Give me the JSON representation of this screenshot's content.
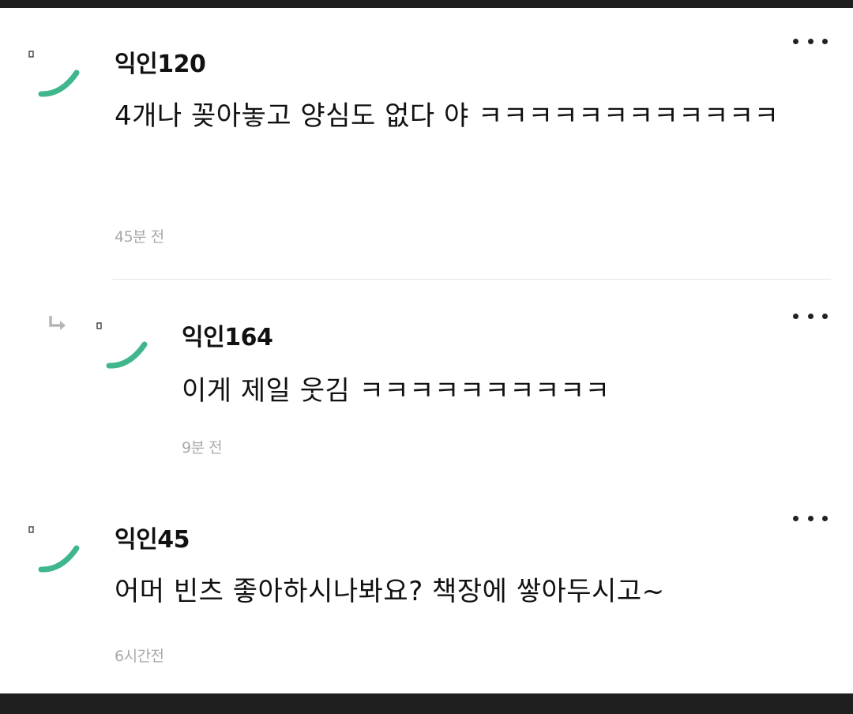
{
  "comments": [
    {
      "username": "익인120",
      "text": "4개나 꽂아놓고 양심도 없다 야 ㅋㅋㅋㅋㅋㅋㅋㅋㅋㅋㅋㅋ",
      "time": "45분 전",
      "avatar_icon": "avatar-arc-icon",
      "is_reply": false
    },
    {
      "username": "익인164",
      "text": "이게 제일 웃김 ㅋㅋㅋㅋㅋㅋㅋㅋㅋㅋ",
      "time": "9분 전",
      "avatar_icon": "avatar-arc-icon",
      "is_reply": true
    },
    {
      "username": "익인45",
      "text": "어머 빈츠 좋아하시나봐요? 책장에 쌓아두시고~",
      "time": "6시간전",
      "avatar_icon": "avatar-arc-icon",
      "is_reply": false
    }
  ],
  "colors": {
    "avatar_accent": "#3fb68b",
    "reply_arrow": "#b5b5b5",
    "time_text": "#a9a9a9",
    "background_bar": "#1f1f1f"
  },
  "icons": {
    "more": "more-options-icon",
    "reply": "reply-arrow-icon"
  }
}
